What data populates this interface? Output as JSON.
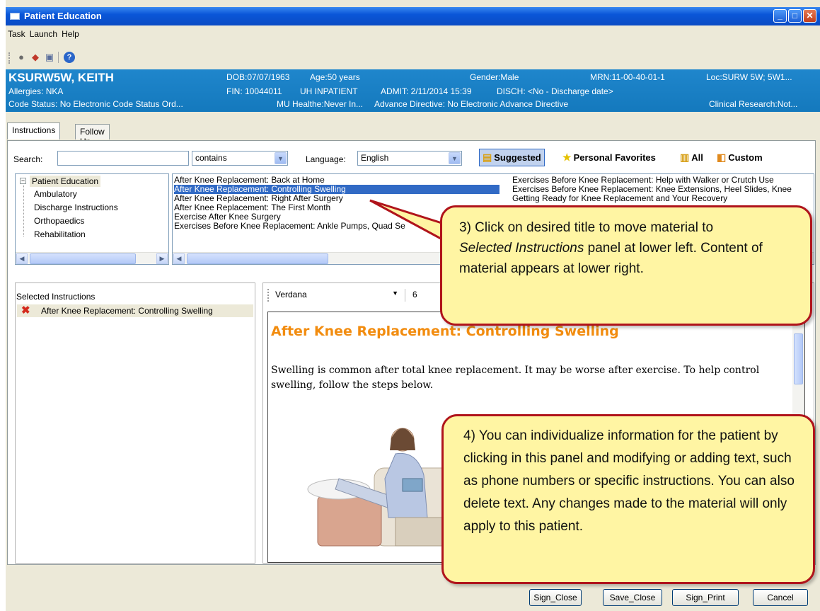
{
  "window": {
    "title": "Patient Education"
  },
  "menu": [
    "Task",
    "Launch",
    "Help"
  ],
  "toolbar": {
    "icons": [
      "bell-icon",
      "tag-icon",
      "document-icon",
      "help-icon"
    ]
  },
  "patient": {
    "name": "KSURW5W, KEITH",
    "allergies": "Allergies: NKA",
    "dob": "DOB:07/07/1963",
    "age": "Age:50 years",
    "gender": "Gender:Male",
    "mrn": "MRN:11-00-40-01-1",
    "loc": "Loc:SURW 5W; 5W1...",
    "fin": "FIN: 10044011",
    "encounter": "UH INPATIENT",
    "admit": "ADMIT: 2/11/2014 15:39",
    "disch": "DISCH:  <No - Discharge date>",
    "code_status": "Code Status: No Electronic Code Status Ord...",
    "mu": "MU Healthe:Never In...",
    "advance_directive": "Advance Directive:  No Electronic Advance Directive",
    "clinical_research": "Clinical Research:Not..."
  },
  "tabs": [
    "Instructions",
    "Follow Up"
  ],
  "search": {
    "label": "Search:",
    "value": "",
    "mode": "contains",
    "language_label": "Language:",
    "language": "English"
  },
  "filters": [
    "Suggested",
    "Personal Favorites",
    "All",
    "Custom"
  ],
  "tree": {
    "root": "Patient Education",
    "children": [
      "Ambulatory",
      "Discharge Instructions",
      "Orthopaedics",
      "Rehabilitation"
    ]
  },
  "titles_left": [
    "After Knee Replacement: Back at Home",
    "After Knee Replacement: Controlling Swelling",
    "After Knee Replacement: Right After Surgery",
    "After Knee Replacement: The First Month",
    "Exercise After Knee Surgery",
    "Exercises Before Knee Replacement: Ankle Pumps, Quad Se"
  ],
  "titles_right": [
    "Exercises Before Knee Replacement: Help with Walker or Crutch Use",
    "Exercises Before Knee Replacement: Knee Extensions, Heel Slides, Knee",
    "Getting Ready for Knee Replacement and Your Recovery"
  ],
  "selected_instructions": {
    "label": "Selected Instructions",
    "items": [
      "After Knee Replacement: Controlling Swelling"
    ]
  },
  "editor": {
    "font": "Verdana",
    "size": "6",
    "heading": "After Knee Replacement: Controlling Swelling",
    "body": "Swelling is common after total knee replacement. It may be worse after exercise. To help control swelling, follow the steps below."
  },
  "buttons": [
    "Sign_Close",
    "Save_Close",
    "Sign_Print",
    "Cancel"
  ],
  "callouts": {
    "step3_a": "3) Click on desired title to move material to",
    "step3_b": "Selected Instructions",
    "step3_c": " panel at lower left. Content of material appears at lower right.",
    "step4": "4) You can individualize information for the patient by clicking in this panel and modifying or adding text, such as phone numbers or specific instructions.  You can also delete text.  Any changes made to the material will only apply to this patient."
  },
  "colors": {
    "title_bar": "#0a56d8",
    "banner": "#1a80c4",
    "selection": "#316ac5",
    "doc_heading": "#f28c0f",
    "callout_fill": "#fff5a3",
    "callout_border": "#b0141b"
  }
}
